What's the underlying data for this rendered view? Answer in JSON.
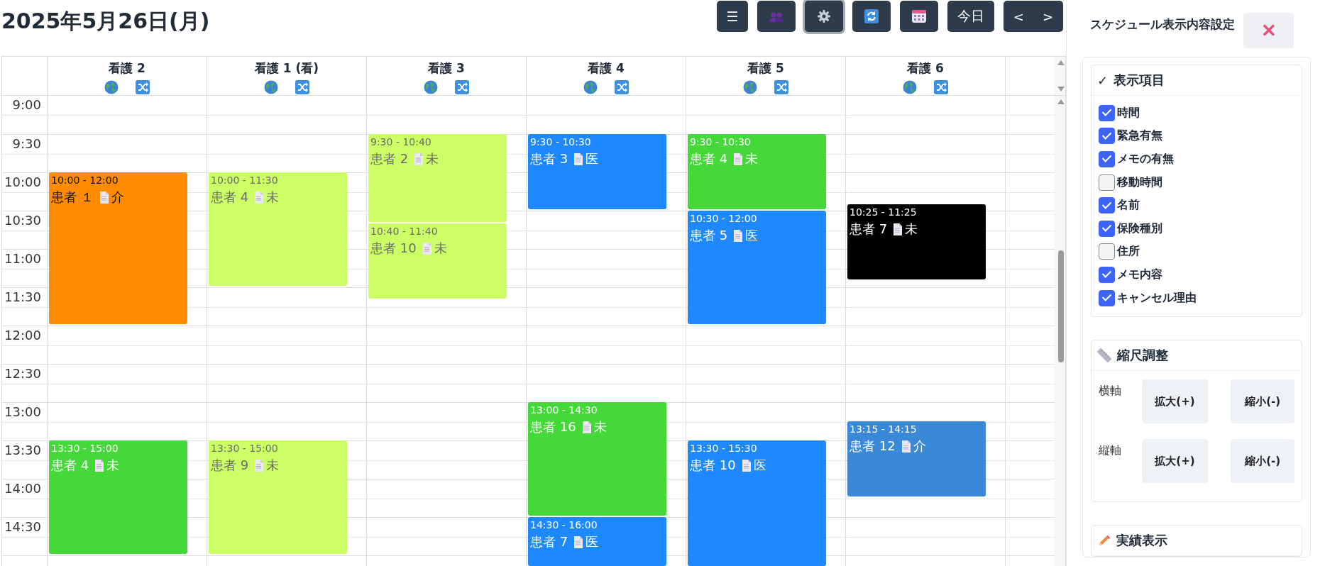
{
  "title": "2025年5月26日(月)",
  "toolbar": [
    {
      "kind": "menu",
      "label": "☰",
      "selected": false
    },
    {
      "kind": "people",
      "selected": false
    },
    {
      "kind": "gear",
      "selected": true
    },
    {
      "kind": "refresh",
      "selected": false
    },
    {
      "kind": "calendar",
      "selected": false
    },
    {
      "kind": "text",
      "label": "今日",
      "selected": false
    },
    {
      "kind": "nav",
      "labels": [
        "<",
        ">"
      ],
      "selected": false
    }
  ],
  "times": [
    "9:00",
    "9:30",
    "10:00",
    "10:30",
    "11:00",
    "11:30",
    "12:00",
    "12:30",
    "13:00",
    "13:30",
    "14:00",
    "14:30"
  ],
  "columns": [
    {
      "name": "看護 2",
      "events": [
        {
          "time": "10:00 - 12:00",
          "patient": "患者 １",
          "type": "介",
          "color": "#ff8c00"
        },
        {
          "time": "13:30 - 15:00",
          "patient": "患者 4",
          "type": "未",
          "color": "#44d838"
        }
      ]
    },
    {
      "name": "看護 1 (看)",
      "events": [
        {
          "time": "10:00 - 11:30",
          "patient": "患者 4",
          "type": "未",
          "color": "#ccff66"
        },
        {
          "time": "13:30 - 15:00",
          "patient": "患者 9",
          "type": "未",
          "color": "#ccff66"
        }
      ]
    },
    {
      "name": "看護 3",
      "events": [
        {
          "time": "9:30 - 10:40",
          "patient": "患者 2",
          "type": "未",
          "color": "#ccff66"
        },
        {
          "time": "10:40 - 11:40",
          "patient": "患者 10",
          "type": "未",
          "color": "#ccff66"
        }
      ]
    },
    {
      "name": "看護 4",
      "events": [
        {
          "time": "9:30 - 10:30",
          "patient": "患者 3",
          "type": "医",
          "color": "#1e88ff"
        },
        {
          "time": "13:00 - 14:30",
          "patient": "患者 16",
          "type": "未",
          "color": "#44d838"
        },
        {
          "time": "14:30 - 16:00",
          "patient": "患者 7",
          "type": "医",
          "color": "#1e88ff"
        }
      ]
    },
    {
      "name": "看護 5",
      "events": [
        {
          "time": "9:30 - 10:30",
          "patient": "患者 4",
          "type": "未",
          "color": "#44d838"
        },
        {
          "time": "10:30 - 12:00",
          "patient": "患者 5",
          "type": "医",
          "color": "#1e88ff"
        },
        {
          "time": "13:30 - 15:30",
          "patient": "患者 10",
          "type": "医",
          "color": "#1e88ff"
        }
      ]
    },
    {
      "name": "看護 6",
      "events": [
        {
          "time": "10:25 - 11:25",
          "patient": "患者 7",
          "type": "未",
          "color": "#000000"
        },
        {
          "time": "13:15 - 14:15",
          "patient": "患者 12",
          "type": "介",
          "color": "#3a88d8"
        }
      ]
    }
  ],
  "panel": {
    "title": "スケジュール表示内容設定",
    "close": "✕",
    "display_section": {
      "check_mark": "✓",
      "title": "表示項目",
      "items": [
        {
          "label": "時間",
          "checked": true
        },
        {
          "label": "緊急有無",
          "checked": true
        },
        {
          "label": "メモの有無",
          "checked": true
        },
        {
          "label": "移動時間",
          "checked": false
        },
        {
          "label": "名前",
          "checked": true
        },
        {
          "label": "保険種別",
          "checked": true
        },
        {
          "label": "住所",
          "checked": false
        },
        {
          "label": "メモ内容",
          "checked": true
        },
        {
          "label": "キャンセル理由",
          "checked": true
        }
      ]
    },
    "scale_section": {
      "title": "縮尺調整",
      "rows": [
        {
          "axis": "横軸",
          "buttons": [
            "拡大(+)",
            "縮小(-)"
          ]
        },
        {
          "axis": "縦軸",
          "buttons": [
            "拡大(+)",
            "縮小(-)"
          ]
        }
      ]
    },
    "results_section": {
      "title": "実績表示"
    }
  }
}
